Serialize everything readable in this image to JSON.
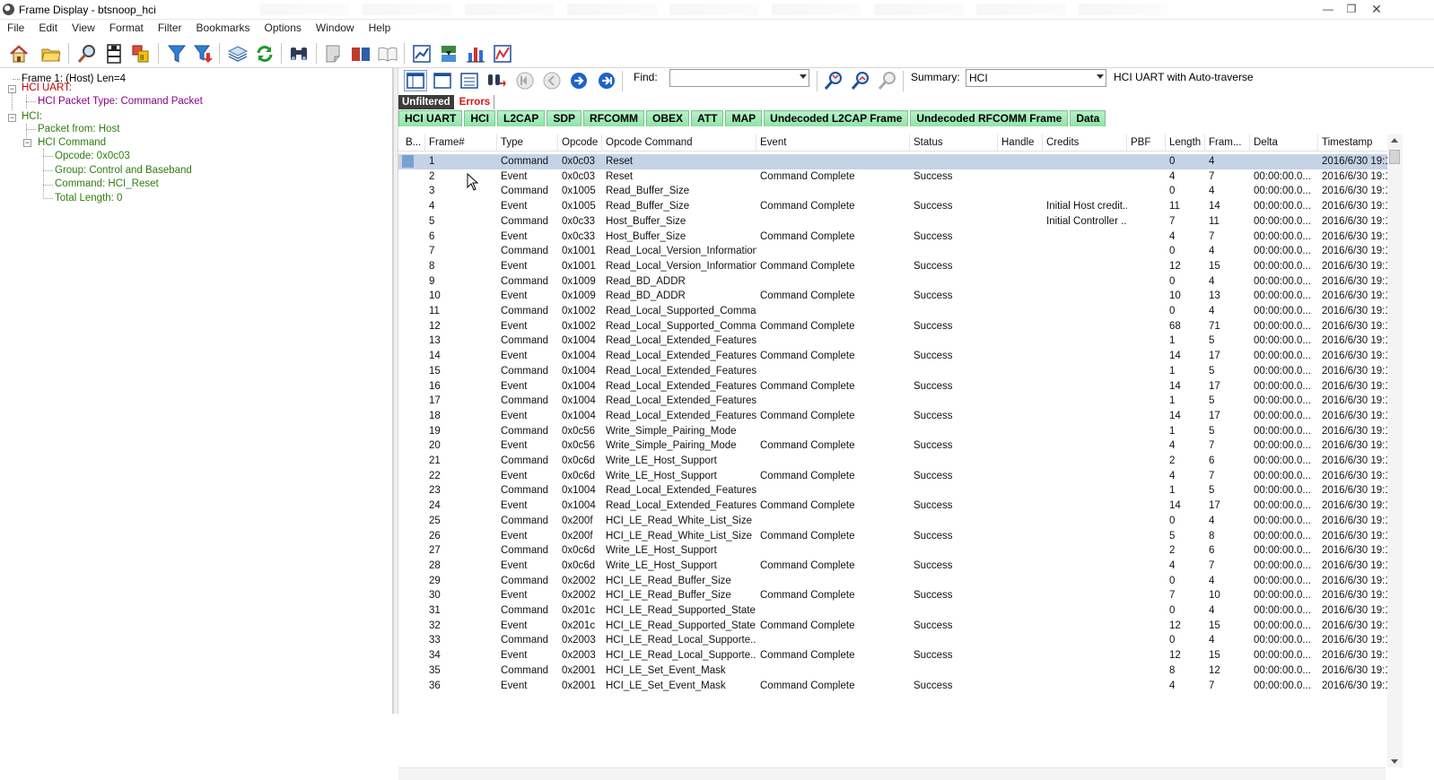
{
  "window": {
    "title": "Frame Display - btsnoop_hci",
    "controls": [
      "minimize",
      "restore",
      "close"
    ]
  },
  "menu": [
    "File",
    "Edit",
    "View",
    "Format",
    "Filter",
    "Bookmarks",
    "Options",
    "Window",
    "Help"
  ],
  "toolbar_icons": [
    "home-icon",
    "open-folder-icon",
    "magnifier-icon",
    "frame-icon",
    "coins-icon",
    "filter-icon",
    "filter-red-icon",
    "layers-icon",
    "refresh-icon",
    "binoculars-icon",
    "note-icon",
    "book-icon",
    "open-book-icon",
    "chart-icon",
    "chip-icon",
    "bar-chart-icon",
    "line-chart-icon"
  ],
  "tree": {
    "frame": "Frame 1: (Host) Len=4",
    "hci_uart": "HCI UART:",
    "packet_type": "HCI Packet Type: Command Packet",
    "hci": "HCI:",
    "packet_from": "Packet from: Host",
    "hci_command": "HCI Command",
    "opcode": "Opcode: 0x0c03",
    "group": "Group: Control and Baseband",
    "command": "Command: HCI_Reset",
    "total_length": "Total Length: 0"
  },
  "frame_toolbar": {
    "find_label": "Find:",
    "find_value": "",
    "summary_label": "Summary:",
    "summary_value": "HCI",
    "summary_note": "HCI UART with Auto-traverse"
  },
  "filter_tabs": {
    "unfiltered": "Unfiltered",
    "errors": "Errors"
  },
  "protocol_tabs": [
    "HCI UART",
    "HCI",
    "L2CAP",
    "SDP",
    "RFCOMM",
    "OBEX",
    "ATT",
    "MAP",
    "Undecoded L2CAP Frame",
    "Undecoded RFCOMM Frame",
    "Data"
  ],
  "columns": [
    "B...",
    "Frame#",
    "Type",
    "Opcode",
    "Opcode Command",
    "Event",
    "Status",
    "Handle",
    "Credits",
    "PBF",
    "Length",
    "Fram...",
    "Delta",
    "Timestamp"
  ],
  "rows": [
    [
      "1",
      "Command",
      "0x0c03",
      "Reset",
      "",
      "",
      "",
      "",
      "",
      "0",
      "4",
      "",
      "2016/6/30 19:1"
    ],
    [
      "2",
      "Event",
      "0x0c03",
      "Reset",
      "Command Complete",
      "Success",
      "",
      "",
      "",
      "4",
      "7",
      "00:00:00.0...",
      "2016/6/30 19:1"
    ],
    [
      "3",
      "Command",
      "0x1005",
      "Read_Buffer_Size",
      "",
      "",
      "",
      "",
      "",
      "0",
      "4",
      "00:00:00.0...",
      "2016/6/30 19:1"
    ],
    [
      "4",
      "Event",
      "0x1005",
      "Read_Buffer_Size",
      "Command Complete",
      "Success",
      "",
      "Initial Host credit...",
      "",
      "11",
      "14",
      "00:00:00.0...",
      "2016/6/30 19:1"
    ],
    [
      "5",
      "Command",
      "0x0c33",
      "Host_Buffer_Size",
      "",
      "",
      "",
      "Initial Controller ...",
      "",
      "7",
      "11",
      "00:00:00.0...",
      "2016/6/30 19:1"
    ],
    [
      "6",
      "Event",
      "0x0c33",
      "Host_Buffer_Size",
      "Command Complete",
      "Success",
      "",
      "",
      "",
      "4",
      "7",
      "00:00:00.0...",
      "2016/6/30 19:1"
    ],
    [
      "7",
      "Command",
      "0x1001",
      "Read_Local_Version_Information",
      "",
      "",
      "",
      "",
      "",
      "0",
      "4",
      "00:00:00.0...",
      "2016/6/30 19:1"
    ],
    [
      "8",
      "Event",
      "0x1001",
      "Read_Local_Version_Information",
      "Command Complete",
      "Success",
      "",
      "",
      "",
      "12",
      "15",
      "00:00:00.0...",
      "2016/6/30 19:1"
    ],
    [
      "9",
      "Command",
      "0x1009",
      "Read_BD_ADDR",
      "",
      "",
      "",
      "",
      "",
      "0",
      "4",
      "00:00:00.0...",
      "2016/6/30 19:1"
    ],
    [
      "10",
      "Event",
      "0x1009",
      "Read_BD_ADDR",
      "Command Complete",
      "Success",
      "",
      "",
      "",
      "10",
      "13",
      "00:00:00.0...",
      "2016/6/30 19:1"
    ],
    [
      "11",
      "Command",
      "0x1002",
      "Read_Local_Supported_Comma...",
      "",
      "",
      "",
      "",
      "",
      "0",
      "4",
      "00:00:00.0...",
      "2016/6/30 19:1"
    ],
    [
      "12",
      "Event",
      "0x1002",
      "Read_Local_Supported_Comma...",
      "Command Complete",
      "Success",
      "",
      "",
      "",
      "68",
      "71",
      "00:00:00.0...",
      "2016/6/30 19:1"
    ],
    [
      "13",
      "Command",
      "0x1004",
      "Read_Local_Extended_Features",
      "",
      "",
      "",
      "",
      "",
      "1",
      "5",
      "00:00:00.0...",
      "2016/6/30 19:1"
    ],
    [
      "14",
      "Event",
      "0x1004",
      "Read_Local_Extended_Features",
      "Command Complete",
      "Success",
      "",
      "",
      "",
      "14",
      "17",
      "00:00:00.0...",
      "2016/6/30 19:1"
    ],
    [
      "15",
      "Command",
      "0x1004",
      "Read_Local_Extended_Features",
      "",
      "",
      "",
      "",
      "",
      "1",
      "5",
      "00:00:00.0...",
      "2016/6/30 19:1"
    ],
    [
      "16",
      "Event",
      "0x1004",
      "Read_Local_Extended_Features",
      "Command Complete",
      "Success",
      "",
      "",
      "",
      "14",
      "17",
      "00:00:00.0...",
      "2016/6/30 19:1"
    ],
    [
      "17",
      "Command",
      "0x1004",
      "Read_Local_Extended_Features",
      "",
      "",
      "",
      "",
      "",
      "1",
      "5",
      "00:00:00.0...",
      "2016/6/30 19:1"
    ],
    [
      "18",
      "Event",
      "0x1004",
      "Read_Local_Extended_Features",
      "Command Complete",
      "Success",
      "",
      "",
      "",
      "14",
      "17",
      "00:00:00.0...",
      "2016/6/30 19:1"
    ],
    [
      "19",
      "Command",
      "0x0c56",
      "Write_Simple_Pairing_Mode",
      "",
      "",
      "",
      "",
      "",
      "1",
      "5",
      "00:00:00.0...",
      "2016/6/30 19:1"
    ],
    [
      "20",
      "Event",
      "0x0c56",
      "Write_Simple_Pairing_Mode",
      "Command Complete",
      "Success",
      "",
      "",
      "",
      "4",
      "7",
      "00:00:00.0...",
      "2016/6/30 19:1"
    ],
    [
      "21",
      "Command",
      "0x0c6d",
      "Write_LE_Host_Support",
      "",
      "",
      "",
      "",
      "",
      "2",
      "6",
      "00:00:00.0...",
      "2016/6/30 19:1"
    ],
    [
      "22",
      "Event",
      "0x0c6d",
      "Write_LE_Host_Support",
      "Command Complete",
      "Success",
      "",
      "",
      "",
      "4",
      "7",
      "00:00:00.0...",
      "2016/6/30 19:1"
    ],
    [
      "23",
      "Command",
      "0x1004",
      "Read_Local_Extended_Features",
      "",
      "",
      "",
      "",
      "",
      "1",
      "5",
      "00:00:00.0...",
      "2016/6/30 19:1"
    ],
    [
      "24",
      "Event",
      "0x1004",
      "Read_Local_Extended_Features",
      "Command Complete",
      "Success",
      "",
      "",
      "",
      "14",
      "17",
      "00:00:00.0...",
      "2016/6/30 19:1"
    ],
    [
      "25",
      "Command",
      "0x200f",
      "HCI_LE_Read_White_List_Size",
      "",
      "",
      "",
      "",
      "",
      "0",
      "4",
      "00:00:00.0...",
      "2016/6/30 19:1"
    ],
    [
      "26",
      "Event",
      "0x200f",
      "HCI_LE_Read_White_List_Size",
      "Command Complete",
      "Success",
      "",
      "",
      "",
      "5",
      "8",
      "00:00:00.0...",
      "2016/6/30 19:1"
    ],
    [
      "27",
      "Command",
      "0x0c6d",
      "Write_LE_Host_Support",
      "",
      "",
      "",
      "",
      "",
      "2",
      "6",
      "00:00:00.0...",
      "2016/6/30 19:1"
    ],
    [
      "28",
      "Event",
      "0x0c6d",
      "Write_LE_Host_Support",
      "Command Complete",
      "Success",
      "",
      "",
      "",
      "4",
      "7",
      "00:00:00.0...",
      "2016/6/30 19:1"
    ],
    [
      "29",
      "Command",
      "0x2002",
      "HCI_LE_Read_Buffer_Size",
      "",
      "",
      "",
      "",
      "",
      "0",
      "4",
      "00:00:00.0...",
      "2016/6/30 19:1"
    ],
    [
      "30",
      "Event",
      "0x2002",
      "HCI_LE_Read_Buffer_Size",
      "Command Complete",
      "Success",
      "",
      "",
      "",
      "7",
      "10",
      "00:00:00.0...",
      "2016/6/30 19:1"
    ],
    [
      "31",
      "Command",
      "0x201c",
      "HCI_LE_Read_Supported_State",
      "",
      "",
      "",
      "",
      "",
      "0",
      "4",
      "00:00:00.0...",
      "2016/6/30 19:1"
    ],
    [
      "32",
      "Event",
      "0x201c",
      "HCI_LE_Read_Supported_State",
      "Command Complete",
      "Success",
      "",
      "",
      "",
      "12",
      "15",
      "00:00:00.0...",
      "2016/6/30 19:1"
    ],
    [
      "33",
      "Command",
      "0x2003",
      "HCI_LE_Read_Local_Supporte...",
      "",
      "",
      "",
      "",
      "",
      "0",
      "4",
      "00:00:00.0...",
      "2016/6/30 19:1"
    ],
    [
      "34",
      "Event",
      "0x2003",
      "HCI_LE_Read_Local_Supporte...",
      "Command Complete",
      "Success",
      "",
      "",
      "",
      "12",
      "15",
      "00:00:00.0...",
      "2016/6/30 19:1"
    ],
    [
      "35",
      "Command",
      "0x2001",
      "HCI_LE_Set_Event_Mask",
      "",
      "",
      "",
      "",
      "",
      "8",
      "12",
      "00:00:00.0...",
      "2016/6/30 19:1"
    ],
    [
      "36",
      "Event",
      "0x2001",
      "HCI_LE_Set_Event_Mask",
      "Command Complete",
      "Success",
      "",
      "",
      "",
      "4",
      "7",
      "00:00:00.0...",
      "2016/6/30 19:1"
    ]
  ],
  "selected_row": "1",
  "colors": {
    "tree_red": "#c00000",
    "tree_purple": "#8b008b",
    "tree_green": "#2e7d12",
    "selection": "#c5d3e6",
    "tab_green": "#8fe3a7"
  }
}
